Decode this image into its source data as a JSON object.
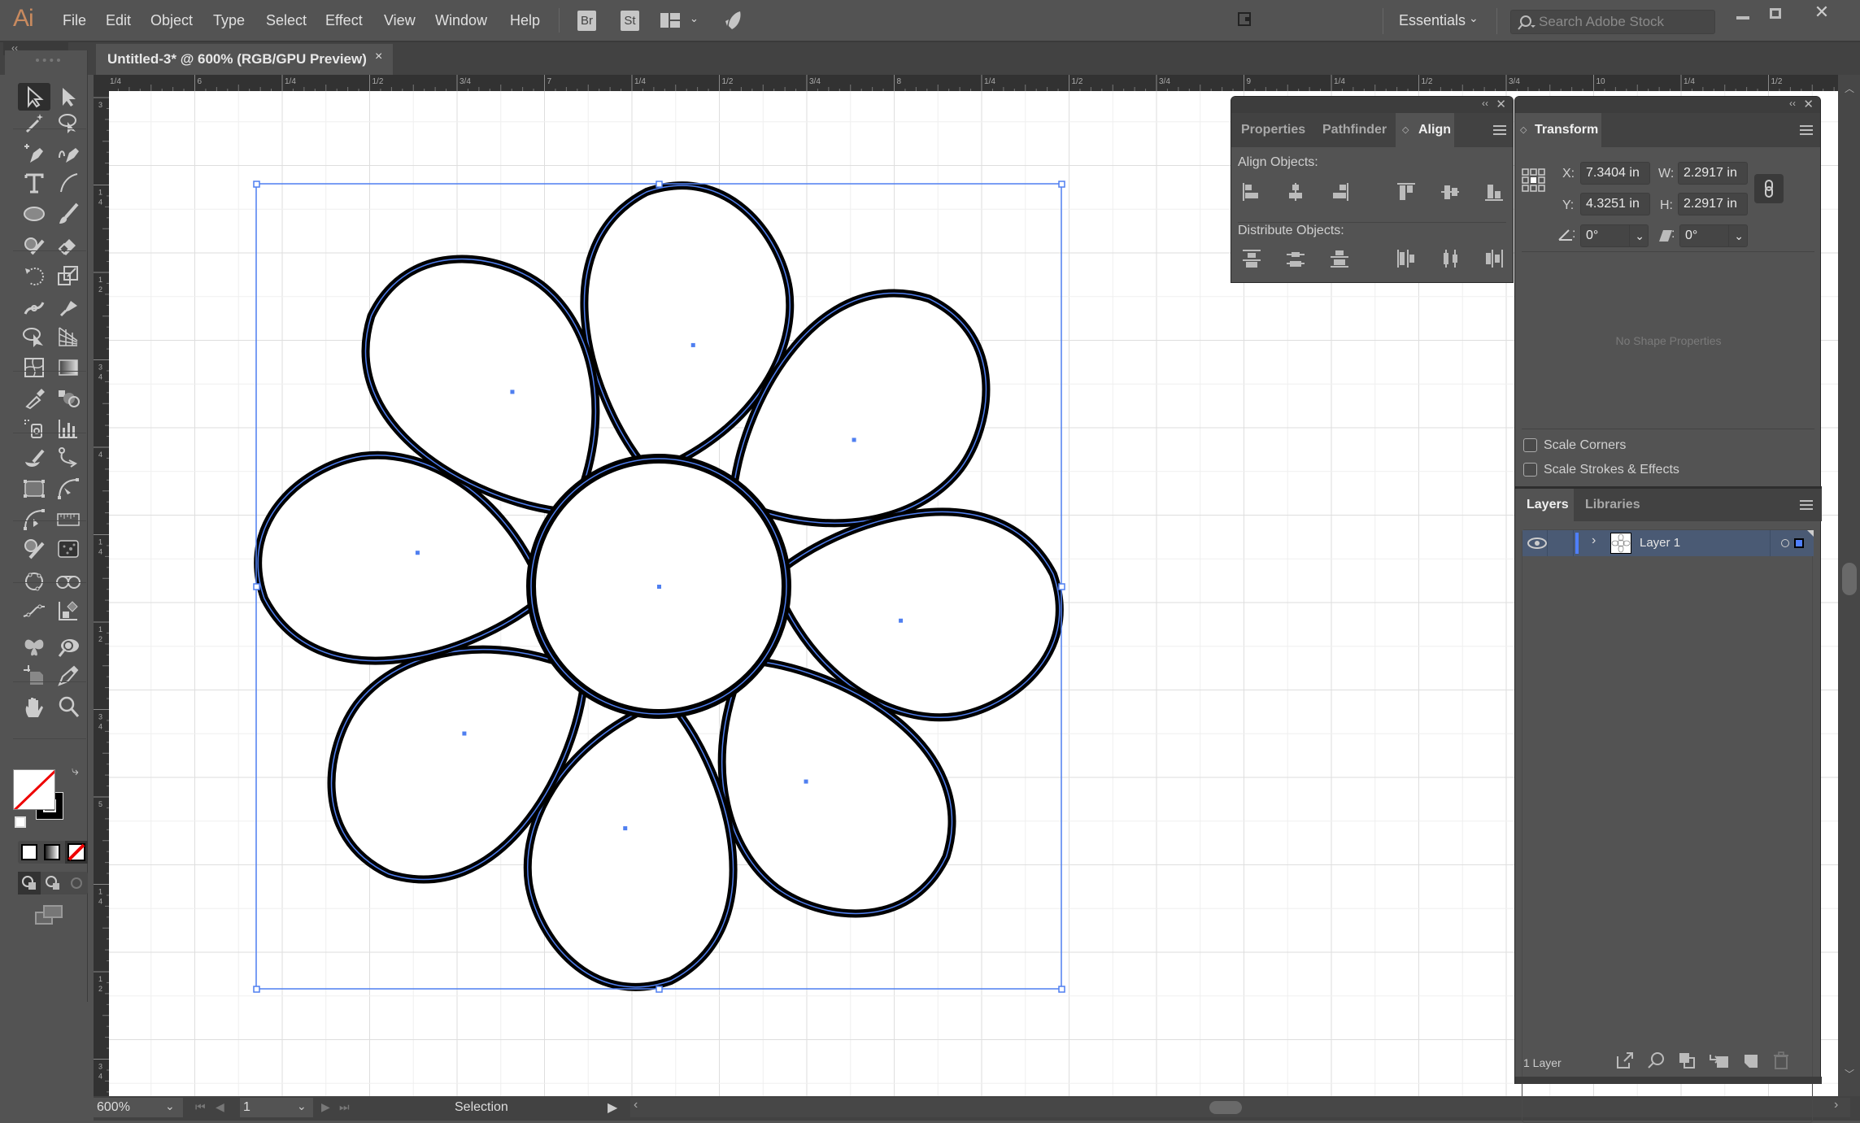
{
  "app": {
    "logo": "Ai",
    "menu": [
      "File",
      "Edit",
      "Object",
      "Type",
      "Select",
      "Effect",
      "View",
      "Window",
      "Help"
    ],
    "bridge_label": "Br",
    "stock_label": "St",
    "workspace": "Essentials",
    "search_placeholder": "Search Adobe Stock",
    "window_controls": {
      "minimize": "—",
      "maximize": "☐",
      "close": "✕"
    }
  },
  "document": {
    "tab_title": "Untitled-3* @ 600% (RGB/GPU Preview)",
    "tab_close": "×",
    "panel_collapse": "‹‹"
  },
  "rulers": {
    "top": [
      "1/4",
      "6",
      "1/4",
      "1/2",
      "3/4",
      "7",
      "1/4",
      "1/2",
      "3/4",
      "8",
      "1/4",
      "1/2",
      "3/4",
      "9",
      "1/4",
      "1/2",
      "3/4",
      "10",
      "1/4",
      "1/2"
    ],
    "left": [
      "3",
      "1/4",
      "1/2",
      "3/4",
      "4",
      "1/4",
      "1/2",
      "3/4",
      "5",
      "1/4",
      "1/2",
      "3/4"
    ]
  },
  "toolbar": {
    "tools": [
      "selection-tool",
      "direct-selection-tool",
      "magic-wand-tool",
      "lasso-tool",
      "pen-tool",
      "curvature-tool",
      "type-tool",
      "line-segment-tool",
      "ellipse-tool",
      "paintbrush-tool",
      "shaper-tool",
      "eraser-tool",
      "rotate-tool",
      "scale-tool",
      "width-tool",
      "puppet-warp-tool",
      "free-transform-tool",
      "perspective-grid-tool",
      "mesh-tool",
      "gradient-tool",
      "eyedropper-tool",
      "blend-tool",
      "symbol-sprayer-tool",
      "column-graph-tool",
      "blob-brush-tool",
      "anchor-point-tool",
      "bounding-box-tool",
      "arc-tool",
      "measure-arc-tool",
      "ruler-tool",
      "brush-shape-tool",
      "texture-tool",
      "circle-path-tool",
      "bridge-path-tool",
      "smooth-path-tool",
      "chart-tool",
      "butterfly-tool",
      "inspect-tool",
      "artboard-tool",
      "knife-tool",
      "hand-tool",
      "zoom-tool"
    ],
    "fill_color": "#ffffff",
    "stroke_color": "#000000"
  },
  "align_panel": {
    "tabs": [
      "Properties",
      "Pathfinder",
      "Align"
    ],
    "active_tab": "Align",
    "align_objects_label": "Align Objects:",
    "distribute_objects_label": "Distribute Objects:"
  },
  "transform_panel": {
    "tab": "Transform",
    "x_label": "X:",
    "x_value": "7.3404 in",
    "y_label": "Y:",
    "y_value": "4.3251 in",
    "w_label": "W:",
    "w_value": "2.2917 in",
    "h_label": "H:",
    "h_value": "2.2917 in",
    "rotate_label": ":",
    "rotate_value": "0°",
    "shear_label": ":",
    "shear_value": "0°",
    "no_shape": "No Shape Properties",
    "scale_corners": "Scale Corners",
    "scale_strokes": "Scale Strokes & Effects",
    "scale_corners_checked": false,
    "scale_strokes_checked": false
  },
  "layers_panel": {
    "tabs": [
      "Layers",
      "Libraries"
    ],
    "active_tab": "Layers",
    "layers": [
      {
        "name": "Layer 1",
        "visible": true,
        "color": "#4f7fff"
      }
    ],
    "footer_count": "1 Layer"
  },
  "status": {
    "zoom": "600%",
    "artboard": "1",
    "tool": "Selection"
  },
  "artwork": {
    "selection_color": "#4f7ff0",
    "stroke_color": "#000000",
    "petal_count": 8
  }
}
